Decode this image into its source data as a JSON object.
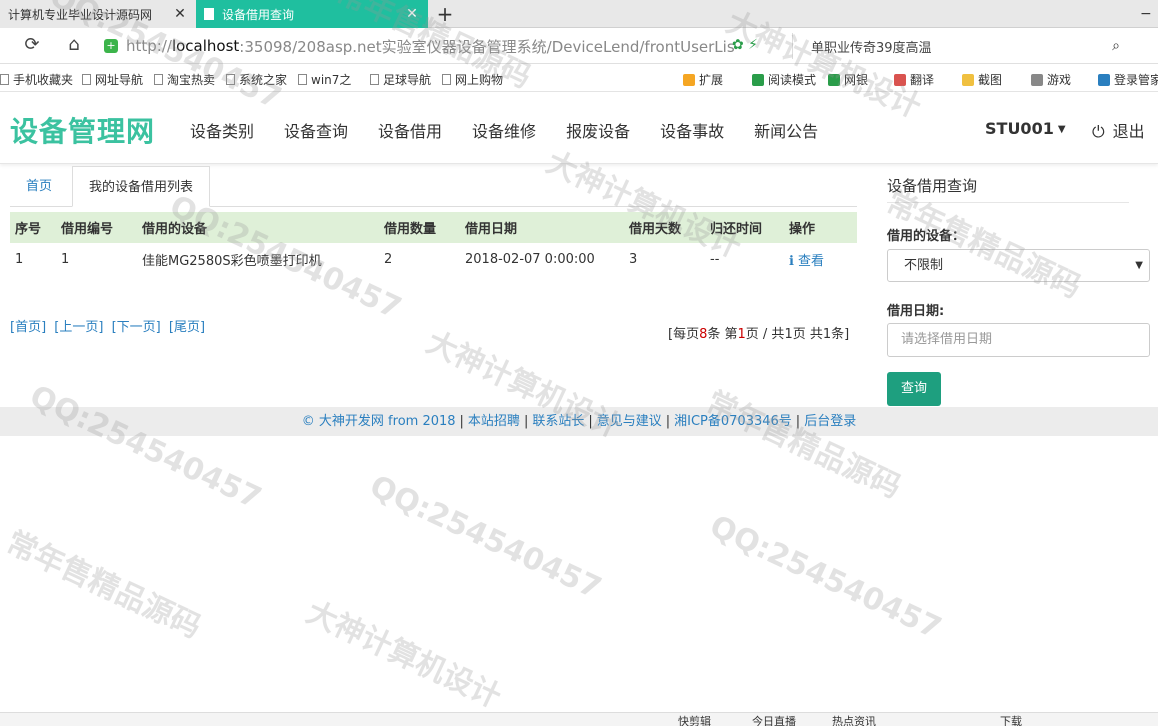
{
  "browser": {
    "tabs": [
      {
        "title": "计算机专业毕业设计源码网",
        "close": "✕"
      },
      {
        "title": "设备借用查询",
        "close": "✕"
      }
    ],
    "new_tab": "+",
    "minimize": "−",
    "url_prefix": "http://",
    "url_host": "localhost",
    "url_rest": ":35098/208asp.net实验室仪器设备管理系统/DeviceLend/frontUserLis",
    "search_text": "单职业传奇39度高温"
  },
  "bookmarks_left": [
    "手机收藏夹",
    "网址导航",
    "淘宝热卖",
    "系统之家",
    "win7之",
    "足球导航",
    "网上购物"
  ],
  "bookmarks_right": [
    {
      "label": "扩展",
      "color": "#f5a623"
    },
    {
      "label": "阅读模式",
      "color": "#2a9d4a"
    },
    {
      "label": "网银",
      "color": "#2a9d4a"
    },
    {
      "label": "翻译",
      "color": "#d9534f"
    },
    {
      "label": "截图",
      "color": "#f0c040"
    },
    {
      "label": "游戏",
      "color": "#888888"
    },
    {
      "label": "登录管家",
      "color": "#2a7fbf"
    }
  ],
  "site": {
    "brand": "设备管理网",
    "nav": [
      "设备类别",
      "设备查询",
      "设备借用",
      "设备维修",
      "报废设备",
      "设备事故",
      "新闻公告"
    ],
    "user": "STU001",
    "logout": "退出"
  },
  "content": {
    "tab_home": "首页",
    "tab_current": "我的设备借用列表",
    "columns": [
      "序号",
      "借用编号",
      "借用的设备",
      "借用数量",
      "借用日期",
      "借用天数",
      "归还时间",
      "操作"
    ],
    "rows": [
      {
        "index": "1",
        "lend_id": "1",
        "device": "佳能MG2580S彩色喷墨打印机",
        "count": "2",
        "date": "2018-02-07 0:00:00",
        "days": "3",
        "return": "--",
        "action": "查看"
      }
    ],
    "pager": [
      "[首页]",
      "[上一页]",
      "[下一页]",
      "[尾页]"
    ],
    "page_info": {
      "prefix": "[每页",
      "per_page": "8",
      "mid1": "条 第",
      "current": "1",
      "mid2": "页 / 共",
      "total_pages": "1",
      "mid3": "页 共",
      "total": "1",
      "suffix": "条]"
    }
  },
  "sidebar": {
    "title": "设备借用查询",
    "device_label": "借用的设备：",
    "device_value": "不限制",
    "date_label": "借用日期:",
    "date_placeholder": "请选择借用日期",
    "query_button": "查询"
  },
  "footer": {
    "copyright": "© 大神开发网 from 2018",
    "links": [
      "本站招聘",
      "联系站长",
      "意见与建议",
      "湘ICP备0703346号",
      "后台登录"
    ]
  },
  "statusbar": [
    "快剪辑",
    "今日直播",
    "热点资讯",
    "下载"
  ],
  "watermarks": [
    "QQ:254540457",
    "常年售精品源码",
    "大神计算机设计"
  ],
  "colors": {
    "brand": "#3bc2a0",
    "active_tab": "#1fbf9f",
    "table_header": "#dff0d8",
    "link": "#2a7fbf",
    "button": "#1e9f7f"
  }
}
